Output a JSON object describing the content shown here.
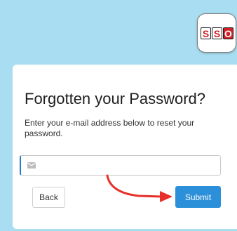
{
  "logo": {
    "letters": [
      "S",
      "S",
      "O"
    ],
    "colors": {
      "red": "#cf2027",
      "outline": "#1a1a1a"
    }
  },
  "page_background": "#a9def2",
  "form": {
    "title": "Forgotten your Password?",
    "description": "Enter your e-mail address below to reset your password.",
    "email": {
      "value": "",
      "placeholder": "",
      "icon": "envelope-icon"
    },
    "back_label": "Back",
    "submit_label": "Submit",
    "submit_color": "#2b90d9"
  },
  "annotation": {
    "type": "arrow",
    "color": "#e8302a",
    "points_to": "submit-button"
  }
}
